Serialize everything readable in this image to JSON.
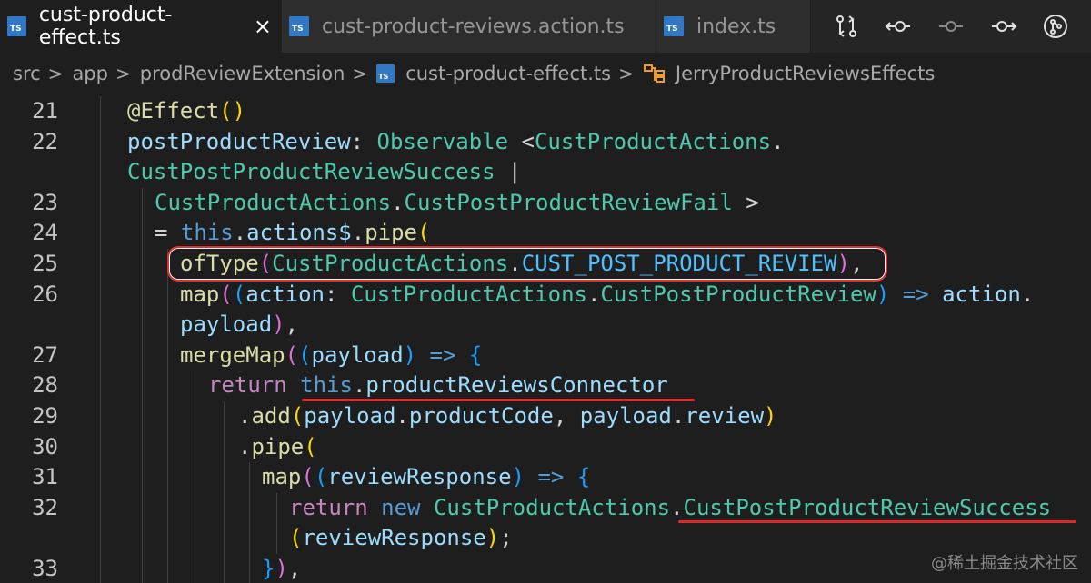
{
  "tabs": [
    {
      "icon": "TS",
      "label": "cust-product-effect.ts",
      "close": "×",
      "active": true
    },
    {
      "icon": "TS",
      "label": "cust-product-reviews.action.ts",
      "active": false
    },
    {
      "icon": "TS",
      "label": "index.ts",
      "active": false
    }
  ],
  "tab_actions": [
    "compare-changes-icon",
    "go-back-icon",
    "go-to-commit-icon",
    "go-forward-icon",
    "source-control-icon"
  ],
  "breadcrumb": {
    "items": [
      "src",
      "app",
      "prodReviewExtension",
      "cust-product-effect.ts",
      "JerryProductReviewsEffects"
    ],
    "file_icon": "TS"
  },
  "code_lines": [
    {
      "n": "21",
      "segments": [
        [
          "dec",
          "@Effect"
        ],
        [
          "br1",
          "()"
        ]
      ]
    },
    {
      "n": "22",
      "segments": [
        [
          "prop",
          "postProductReview"
        ],
        [
          "punc",
          ": "
        ],
        [
          "type",
          "Observable"
        ],
        [
          "punc",
          " <"
        ],
        [
          "type",
          "CustProductActions"
        ],
        [
          "punc",
          "."
        ]
      ]
    },
    {
      "n": "",
      "segments": [
        [
          "type",
          "CustPostProductReviewSuccess"
        ],
        [
          "punc",
          " |"
        ]
      ]
    },
    {
      "n": "23",
      "segments": [
        [
          "type",
          "CustProductActions"
        ],
        [
          "punc",
          "."
        ],
        [
          "type",
          "CustPostProductReviewFail"
        ],
        [
          "punc",
          " >"
        ]
      ]
    },
    {
      "n": "24",
      "segments": [
        [
          "punc",
          "= "
        ],
        [
          "kw",
          "this"
        ],
        [
          "punc",
          "."
        ],
        [
          "prop",
          "actions$"
        ],
        [
          "punc",
          "."
        ],
        [
          "fn",
          "pipe"
        ],
        [
          "br1",
          "("
        ]
      ]
    },
    {
      "n": "25",
      "segments": [
        [
          "fn",
          "ofType"
        ],
        [
          "br2",
          "("
        ],
        [
          "type",
          "CustProductActions"
        ],
        [
          "punc",
          "."
        ],
        [
          "const",
          "CUST_POST_PRODUCT_REVIEW"
        ],
        [
          "br2",
          ")"
        ],
        [
          "punc",
          ","
        ]
      ]
    },
    {
      "n": "26",
      "segments": [
        [
          "fn",
          "map"
        ],
        [
          "br2",
          "("
        ],
        [
          "br3",
          "("
        ],
        [
          "prop",
          "action"
        ],
        [
          "punc",
          ": "
        ],
        [
          "type",
          "CustProductActions"
        ],
        [
          "punc",
          "."
        ],
        [
          "type",
          "CustPostProductReview"
        ],
        [
          "br3",
          ")"
        ],
        [
          "kw",
          " => "
        ],
        [
          "prop",
          "action"
        ],
        [
          "punc",
          "."
        ]
      ]
    },
    {
      "n": "",
      "segments": [
        [
          "prop",
          "payload"
        ],
        [
          "br2",
          ")"
        ],
        [
          "punc",
          ","
        ]
      ]
    },
    {
      "n": "27",
      "segments": [
        [
          "fn",
          "mergeMap"
        ],
        [
          "br2",
          "("
        ],
        [
          "br3",
          "("
        ],
        [
          "prop",
          "payload"
        ],
        [
          "br3",
          ")"
        ],
        [
          "kw",
          " => "
        ],
        [
          "br3",
          "{"
        ]
      ]
    },
    {
      "n": "28",
      "segments": [
        [
          "ctrl",
          "return"
        ],
        [
          "punc",
          " "
        ],
        [
          "kw",
          "this"
        ],
        [
          "punc",
          "."
        ],
        [
          "prop",
          "productReviewsConnector"
        ]
      ]
    },
    {
      "n": "29",
      "segments": [
        [
          "punc",
          "."
        ],
        [
          "fn",
          "add"
        ],
        [
          "br1",
          "("
        ],
        [
          "prop",
          "payload"
        ],
        [
          "punc",
          "."
        ],
        [
          "prop",
          "productCode"
        ],
        [
          "punc",
          ", "
        ],
        [
          "prop",
          "payload"
        ],
        [
          "punc",
          "."
        ],
        [
          "prop",
          "review"
        ],
        [
          "br1",
          ")"
        ]
      ]
    },
    {
      "n": "30",
      "segments": [
        [
          "punc",
          "."
        ],
        [
          "fn",
          "pipe"
        ],
        [
          "br1",
          "("
        ]
      ]
    },
    {
      "n": "31",
      "segments": [
        [
          "fn",
          "map"
        ],
        [
          "br2",
          "("
        ],
        [
          "br3",
          "("
        ],
        [
          "prop",
          "reviewResponse"
        ],
        [
          "br3",
          ")"
        ],
        [
          "kw",
          " => "
        ],
        [
          "br3",
          "{"
        ]
      ]
    },
    {
      "n": "32",
      "segments": [
        [
          "ctrl",
          "return"
        ],
        [
          "punc",
          " "
        ],
        [
          "kw",
          "new"
        ],
        [
          "punc",
          " "
        ],
        [
          "type",
          "CustProductActions"
        ],
        [
          "punc",
          "."
        ],
        [
          "type",
          "CustPostProductReviewSuccess"
        ]
      ]
    },
    {
      "n": "",
      "segments": [
        [
          "br1",
          "("
        ],
        [
          "prop",
          "reviewResponse"
        ],
        [
          "br1",
          ")"
        ],
        [
          "punc",
          ";"
        ]
      ]
    },
    {
      "n": "33",
      "segments": [
        [
          "br3",
          "}"
        ],
        [
          "br2",
          ")"
        ],
        [
          "punc",
          ","
        ]
      ]
    }
  ],
  "watermark": "@稀土掘金技术社区",
  "colors": {
    "background": "#1e1e1e",
    "tabbar": "#252526",
    "highlight": "#e03030",
    "ts_icon": "#3178c6"
  }
}
